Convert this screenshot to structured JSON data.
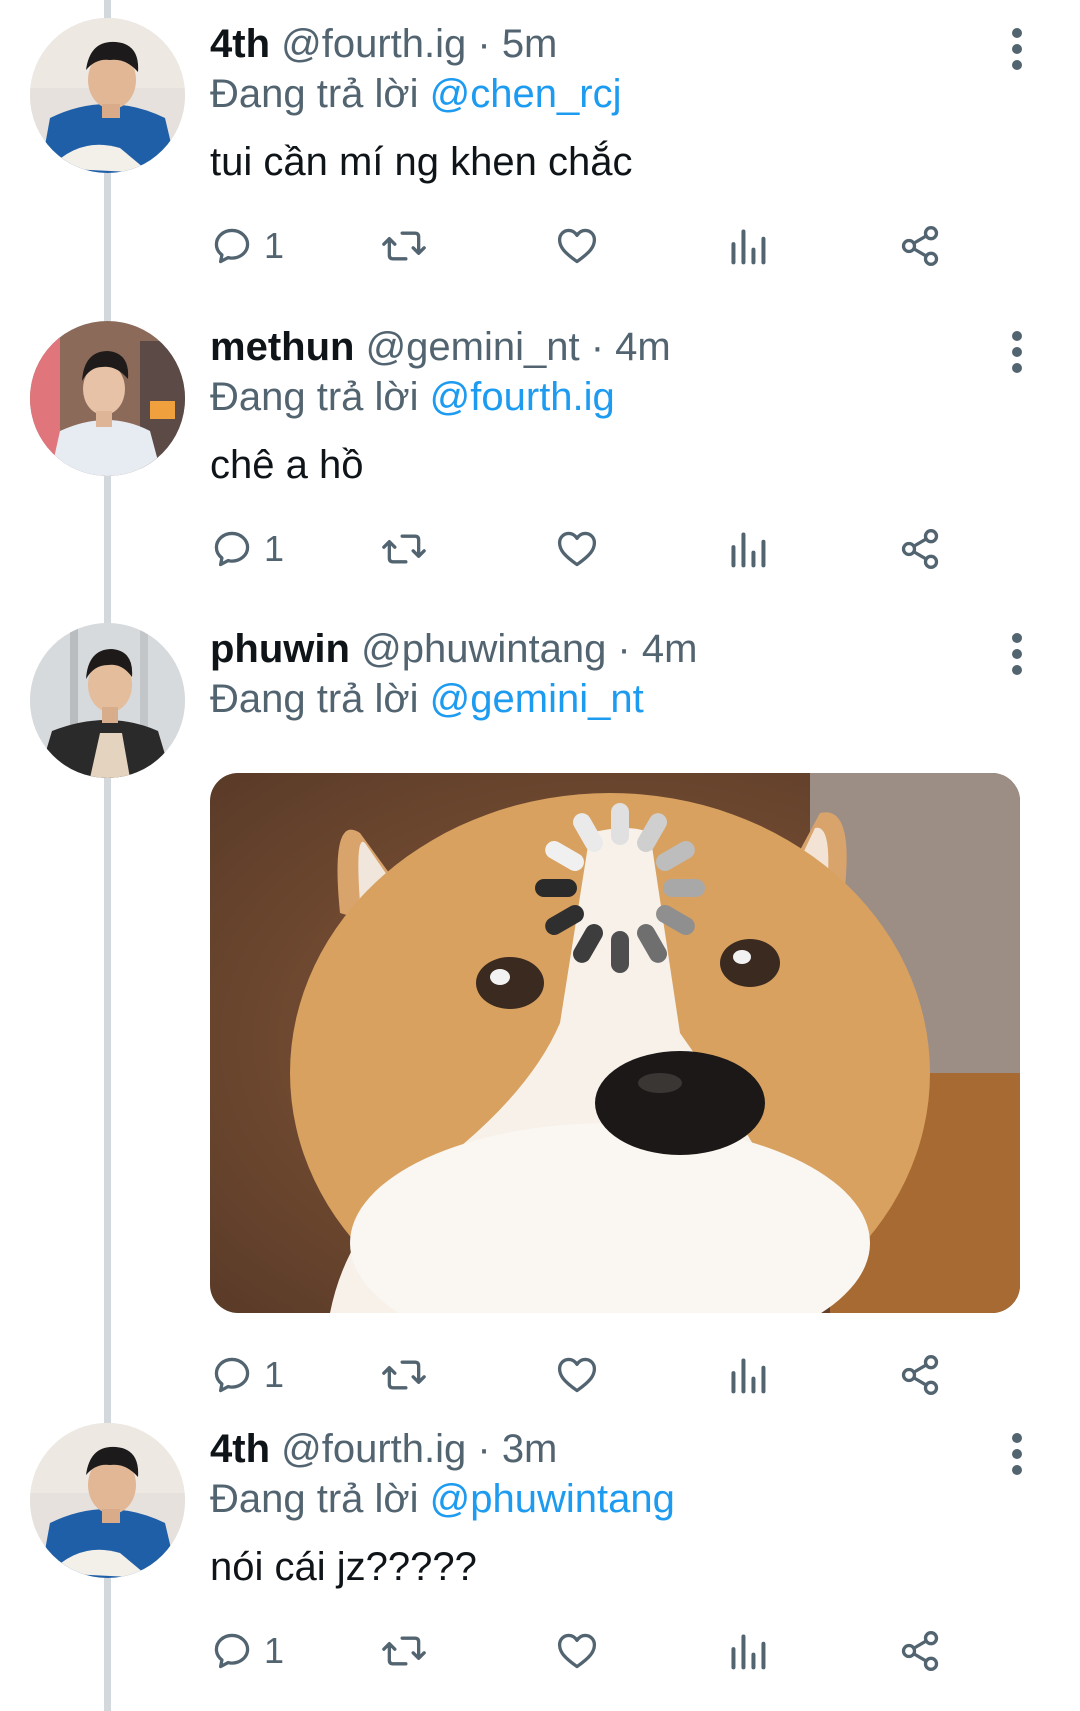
{
  "tweets": [
    {
      "display_name": "4th",
      "handle": "@fourth.ig",
      "separator": " · ",
      "time": "5m",
      "replying_prefix": "Đang trả lời ",
      "replying_to": "@chen_rcj",
      "text": "tui cần mí ng khen chắc",
      "reply_count": "1"
    },
    {
      "display_name": "methun",
      "handle": "@gemini_nt",
      "separator": " · ",
      "time": "4m",
      "replying_prefix": "Đang trả lời ",
      "replying_to": "@fourth.ig",
      "text": "chê a hồ",
      "reply_count": "1"
    },
    {
      "display_name": "phuwin",
      "handle": "@phuwintang",
      "separator": " · ",
      "time": "4m",
      "replying_prefix": "Đang trả lời ",
      "replying_to": "@gemini_nt",
      "media": "corgi-loading-meme",
      "reply_count": "1"
    },
    {
      "display_name": "4th",
      "handle": "@fourth.ig",
      "separator": " · ",
      "time": "3m",
      "replying_prefix": "Đang trả lời ",
      "replying_to": "@phuwintang",
      "text": "nói cái jz?????",
      "reply_count": "1"
    }
  ],
  "icons": {
    "reply": "reply-icon",
    "retweet": "retweet-icon",
    "like": "heart-icon",
    "views": "analytics-icon",
    "share": "share-icon",
    "more": "more-vertical-icon"
  },
  "colors": {
    "mention": "#1d9bf0",
    "muted": "#536471",
    "text": "#0f1419",
    "thread_line": "#d3d8dc"
  }
}
